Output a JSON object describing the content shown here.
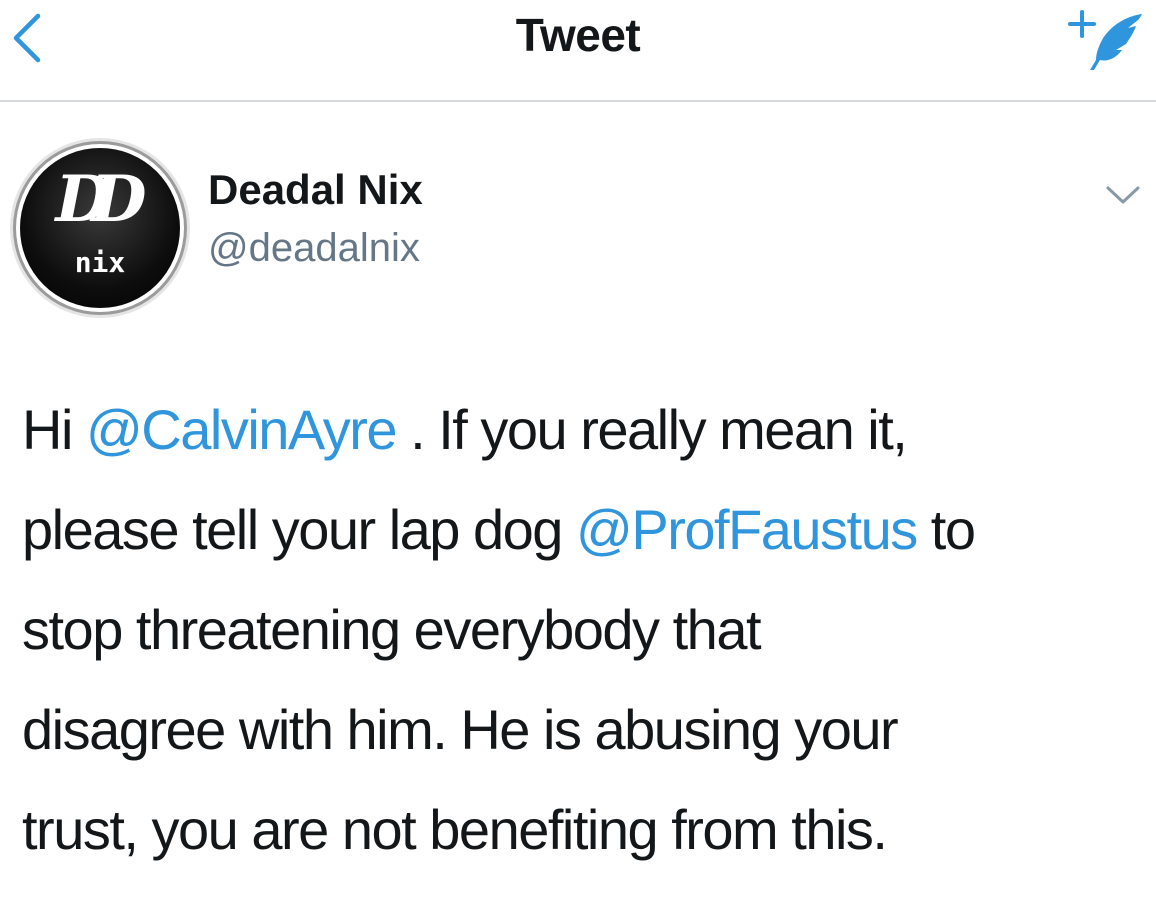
{
  "nav": {
    "title": "Tweet",
    "back_icon": "chevron-left-icon",
    "compose_icon": "compose-tweet-icon"
  },
  "author": {
    "display_name": "Deadal Nix",
    "handle": "@deadalnix",
    "avatar_text_top": "DD",
    "avatar_text_bottom": "nix"
  },
  "tweet": {
    "l1_a": "Hi ",
    "l1_mention": "@CalvinAyre",
    "l1_b": " . If you really mean it,",
    "l2_a": "please tell your lap dog ",
    "l2_mention": "@ProfFaustus",
    "l2_b": " to",
    "l3": "stop threatening everybody that",
    "l4": "disagree with him. He is abusing your",
    "l5": "trust, you are not benefiting from this."
  },
  "colors": {
    "accent": "#2f95dc",
    "text": "#14171a",
    "secondary_text": "#657786",
    "divider": "#d6d9dc"
  }
}
